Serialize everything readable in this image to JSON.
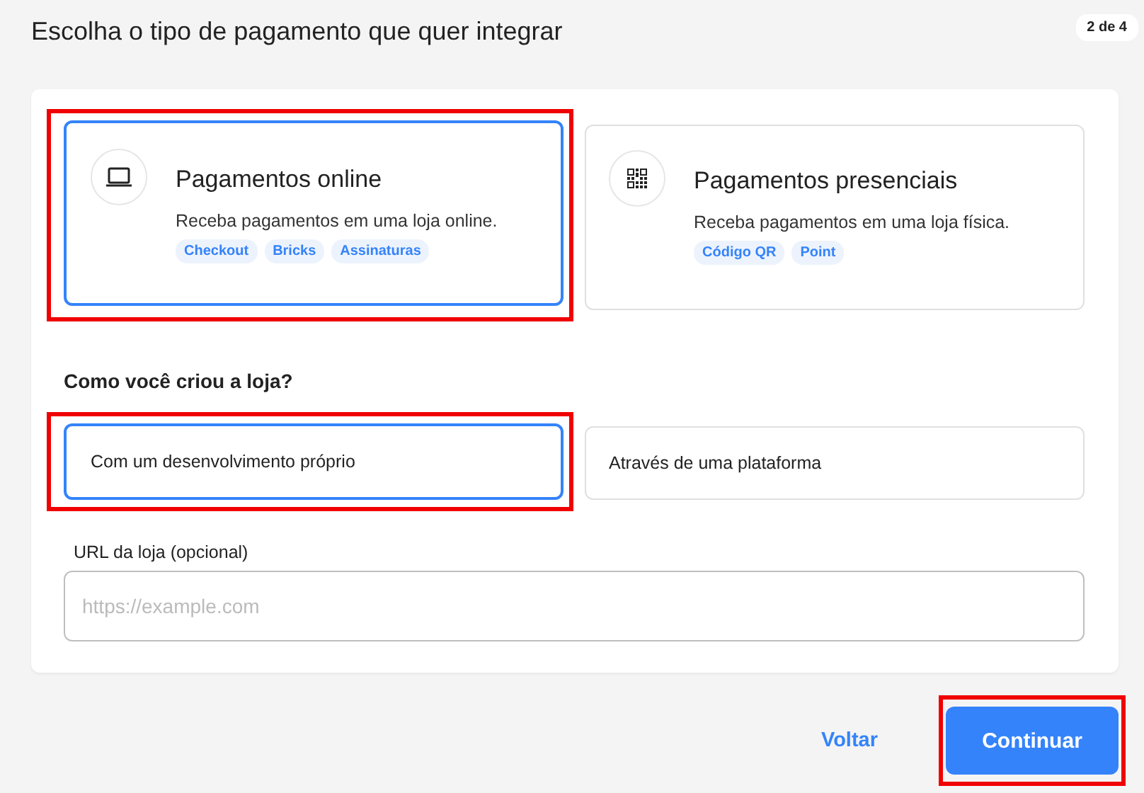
{
  "title": "Escolha o tipo de pagamento que quer integrar",
  "step_badge": "2 de 4",
  "payment_types": [
    {
      "kind": "laptop",
      "title": "Pagamentos online",
      "description": "Receba pagamentos em uma loja online.",
      "tags": [
        "Checkout",
        "Bricks",
        "Assinaturas"
      ],
      "selected": true,
      "highlighted": true
    },
    {
      "kind": "qr",
      "title": "Pagamentos presenciais",
      "description": "Receba pagamentos em uma loja física.",
      "tags": [
        "Código QR",
        "Point"
      ],
      "selected": false,
      "highlighted": false
    }
  ],
  "store_question": "Como você criou a loja?",
  "store_options": [
    {
      "label": "Com um desenvolvimento próprio",
      "selected": true,
      "highlighted": true
    },
    {
      "label": "Através de uma plataforma",
      "selected": false,
      "highlighted": false
    }
  ],
  "url_field": {
    "label": "URL da loja (opcional)",
    "placeholder": "https://example.com"
  },
  "back_button": "Voltar",
  "continue_button": {
    "label": "Continuar",
    "highlighted": true
  }
}
